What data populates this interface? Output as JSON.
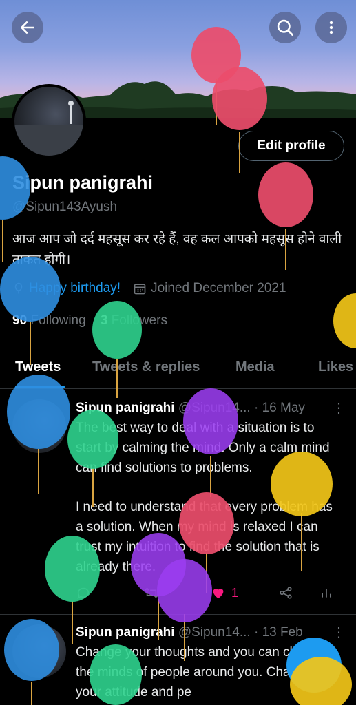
{
  "header": {
    "back_icon": "arrow-left-icon",
    "search_icon": "search-icon",
    "more_icon": "more-vertical-icon"
  },
  "profile": {
    "edit_label": "Edit profile",
    "name": "Sipun panigrahi",
    "handle": "@Sipun143Ayush",
    "bio": "आज आप जो दर्द महसूस कर रहे हैं, वह कल आपको महसूस होने वाली ताकत होगी।",
    "birthday": "Happy birthday!",
    "joined": "Joined December 2021",
    "following_count": "90",
    "following_label": "Following",
    "followers_count": "3",
    "followers_label": "Followers"
  },
  "tabs": [
    {
      "label": "Tweets"
    },
    {
      "label": "Tweets & replies"
    },
    {
      "label": "Media"
    },
    {
      "label": "Likes"
    }
  ],
  "tweets": [
    {
      "name": "Sipun panigrahi",
      "handle": "@Sipun14...",
      "date": "· 16 May",
      "text": "The best way to deal with a situation is to start by calming the mind. Only a calm mind can find solutions to problems.",
      "text2": "I need to understand that every problem has a solution. When my mind is relaxed I can trust my intuition to find the solution that is already there.",
      "likes": "1"
    },
    {
      "name": "Sipun panigrahi",
      "handle": "@Sipun14...",
      "date": "· 13 Feb",
      "text": "Change your thoughts and you can change the minds of people around you. Change your attitude and pe"
    }
  ],
  "colors": {
    "accent": "#1d9bf0",
    "like": "#f91880"
  }
}
